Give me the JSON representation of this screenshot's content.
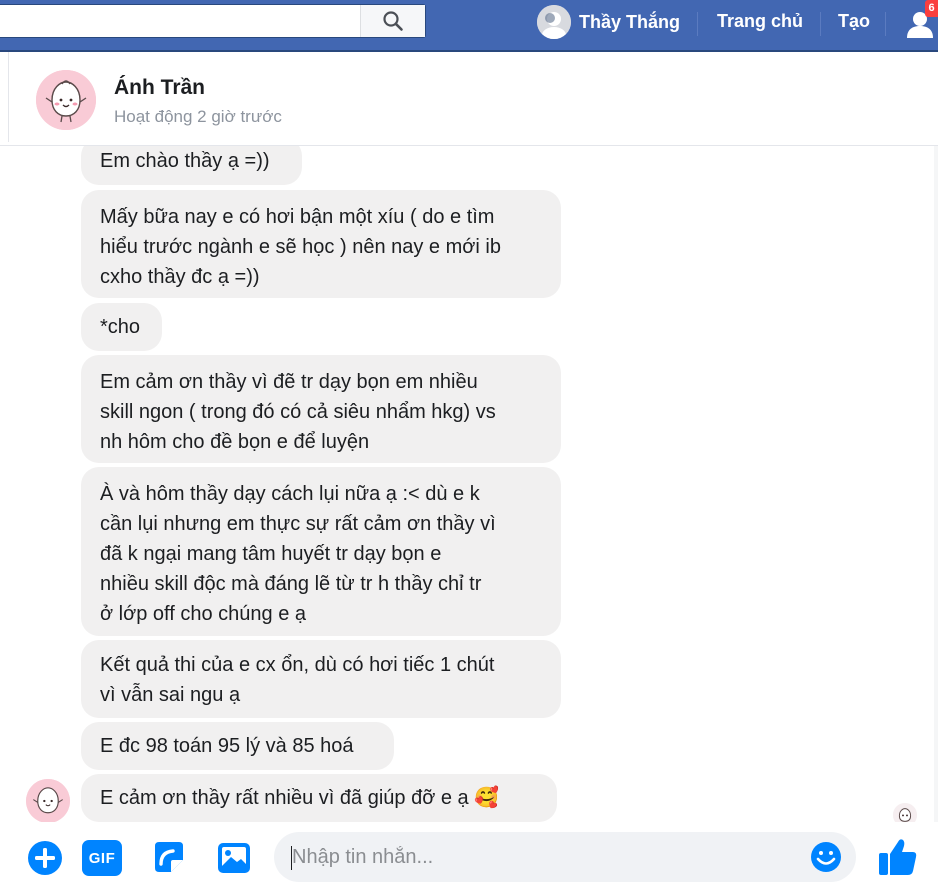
{
  "nav": {
    "profile_name": "Thầy Thắng",
    "home_label": "Trang chủ",
    "create_label": "Tạo",
    "notification_count": "6",
    "search_placeholder": ""
  },
  "chat": {
    "contact_name": "Ánh Trần",
    "status": "Hoạt động 2 giờ trước"
  },
  "messages": [
    {
      "lines": [
        "Em chào thầy ạ =))"
      ]
    },
    {
      "lines": [
        "Mấy bữa nay e có hơi bận một xíu ( do e tìm",
        "hiểu trước ngành e sẽ học ) nên nay e mới ib",
        "cxho thầy đc ạ =))"
      ]
    },
    {
      "lines": [
        "*cho"
      ]
    },
    {
      "lines": [
        "Em cảm ơn thầy vì đẽ tr dạy bọn em nhiều",
        "skill ngon ( trong đó có cả siêu nhẩm hkg) vs",
        "nh hôm cho đề bọn e để luyện"
      ]
    },
    {
      "lines": [
        "À và hôm thầy dạy cách lụi nữa ạ :< dù e k",
        "cần lụi nhưng em thực sự rất cảm ơn thầy vì",
        "đã k ngại mang tâm huyết tr dạy bọn e",
        "nhiều skill độc mà đáng lẽ từ tr h thầy chỉ tr",
        "ở lớp off cho chúng e ạ"
      ]
    },
    {
      "lines": [
        "Kết quả thi của e cx ổn, dù có hơi tiếc 1 chút",
        "vì vẫn sai ngu ạ"
      ]
    },
    {
      "lines": [
        "E đc 98 toán 95 lý và 85 hoá"
      ]
    },
    {
      "lines": [
        "E cảm ơn thầy rất nhiều vì đã giúp đỡ e ạ 🥰"
      ]
    }
  ],
  "composer": {
    "placeholder": "Nhập tin nhắn...",
    "gif_label": "GIF"
  },
  "colors": {
    "nav_bg": "#4267b2",
    "accent": "#0084ff",
    "bubble_bg": "#f1f0f0"
  }
}
